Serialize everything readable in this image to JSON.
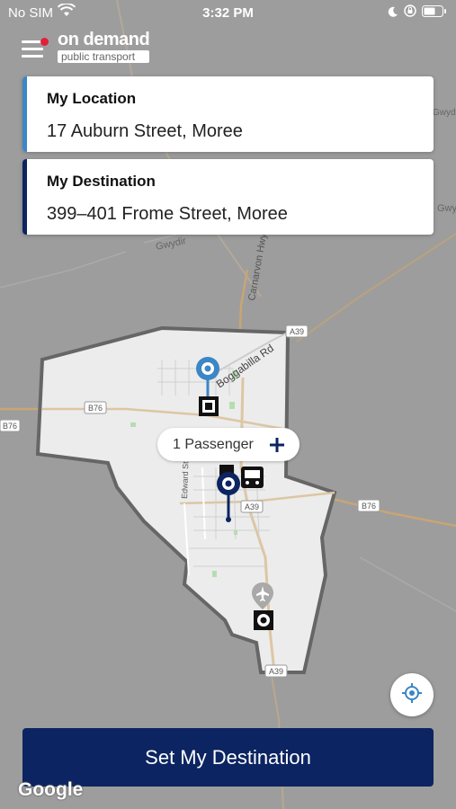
{
  "status_bar": {
    "carrier": "No SIM",
    "time": "3:32 PM"
  },
  "header": {
    "logo_line1": "on demand",
    "logo_line2": "public transport"
  },
  "location_card": {
    "title": "My Location",
    "value": "17 Auburn Street, Moree",
    "accent_color": "#3b86c6"
  },
  "destination_card": {
    "title": "My Destination",
    "value": "399–401 Frome Street, Moree",
    "accent_color": "#0c2461"
  },
  "map": {
    "road_labels": [
      "Boggabilla Rd",
      "Carnarvon Hwy",
      "Gwydir",
      "Gwydir",
      "Gwyd",
      "Edward St"
    ],
    "route_badges": [
      "A39",
      "A39",
      "A39",
      "B76",
      "B76",
      "B76"
    ],
    "icons": [
      "pickup-pin-icon",
      "destination-pin-icon",
      "stop-icon",
      "bus-icon",
      "airport-icon"
    ]
  },
  "passenger": {
    "label": "1 Passenger",
    "add_icon": "plus-icon"
  },
  "locate_button": {
    "icon": "crosshair-icon"
  },
  "cta": {
    "label": "Set My Destination"
  },
  "map_attribution": "Google",
  "colors": {
    "primary": "#0c2461",
    "accent_blue": "#3b86c6",
    "notification_dot": "#e0203c"
  }
}
